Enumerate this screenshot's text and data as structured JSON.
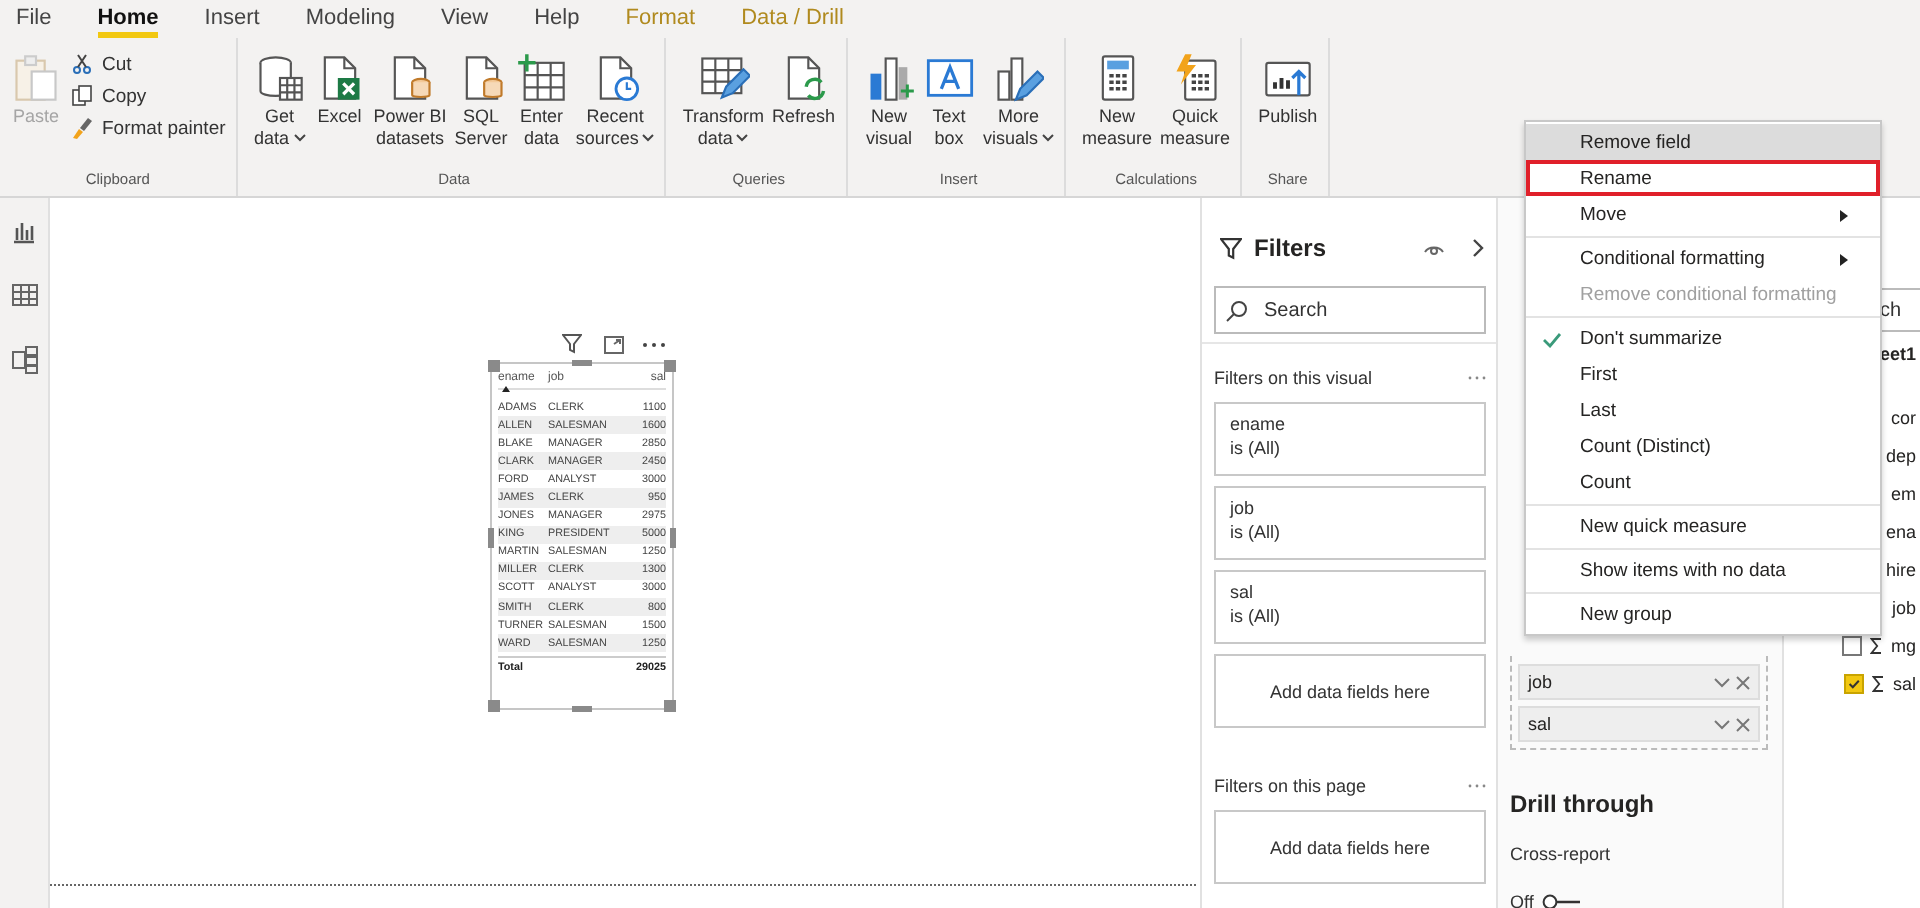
{
  "ribbon_tabs": [
    {
      "label": "File",
      "selected": false,
      "contextual": false
    },
    {
      "label": "Home",
      "selected": true,
      "contextual": false
    },
    {
      "label": "Insert",
      "selected": false,
      "contextual": false
    },
    {
      "label": "Modeling",
      "selected": false,
      "contextual": false
    },
    {
      "label": "View",
      "selected": false,
      "contextual": false
    },
    {
      "label": "Help",
      "selected": false,
      "contextual": false
    },
    {
      "label": "Format",
      "selected": false,
      "contextual": true
    },
    {
      "label": "Data / Drill",
      "selected": false,
      "contextual": true
    }
  ],
  "ribbon_groups": [
    {
      "label": "Clipboard",
      "buttons": [
        {
          "kind": "large",
          "lines": [
            "Paste"
          ],
          "disabled": true,
          "dropdown": false
        },
        {
          "kind": "small",
          "lines": [
            "Cut"
          ],
          "disabled": false,
          "dropdown": false
        },
        {
          "kind": "small",
          "lines": [
            "Copy"
          ],
          "disabled": false,
          "dropdown": false
        },
        {
          "kind": "small",
          "lines": [
            "Format painter"
          ],
          "disabled": false,
          "dropdown": false
        }
      ]
    },
    {
      "label": "Data",
      "buttons": [
        {
          "kind": "large",
          "lines": [
            "Get",
            "data"
          ],
          "disabled": false,
          "dropdown": true
        },
        {
          "kind": "large",
          "lines": [
            "Excel"
          ],
          "disabled": false,
          "dropdown": false
        },
        {
          "kind": "large",
          "lines": [
            "Power BI",
            "datasets"
          ],
          "disabled": false,
          "dropdown": false
        },
        {
          "kind": "large",
          "lines": [
            "SQL",
            "Server"
          ],
          "disabled": false,
          "dropdown": false
        },
        {
          "kind": "large",
          "lines": [
            "Enter",
            "data"
          ],
          "disabled": false,
          "dropdown": false
        },
        {
          "kind": "large",
          "lines": [
            "Recent",
            "sources"
          ],
          "disabled": false,
          "dropdown": true
        }
      ]
    },
    {
      "label": "Queries",
      "buttons": [
        {
          "kind": "large",
          "lines": [
            "Transform",
            "data"
          ],
          "disabled": false,
          "dropdown": true
        },
        {
          "kind": "large",
          "lines": [
            "Refresh"
          ],
          "disabled": false,
          "dropdown": false
        }
      ]
    },
    {
      "label": "Insert",
      "buttons": [
        {
          "kind": "large",
          "lines": [
            "New",
            "visual"
          ],
          "disabled": false,
          "dropdown": false
        },
        {
          "kind": "large",
          "lines": [
            "Text",
            "box"
          ],
          "disabled": false,
          "dropdown": false
        },
        {
          "kind": "large",
          "lines": [
            "More",
            "visuals"
          ],
          "disabled": false,
          "dropdown": true
        }
      ]
    },
    {
      "label": "Calculations",
      "buttons": [
        {
          "kind": "large",
          "lines": [
            "New",
            "measure"
          ],
          "disabled": false,
          "dropdown": false
        },
        {
          "kind": "large",
          "lines": [
            "Quick",
            "measure"
          ],
          "disabled": false,
          "dropdown": false
        }
      ]
    },
    {
      "label": "Share",
      "buttons": [
        {
          "kind": "large",
          "lines": [
            "Publish"
          ],
          "disabled": false,
          "dropdown": false
        }
      ]
    }
  ],
  "table_visual": {
    "columns": [
      "ename",
      "job",
      "sal"
    ],
    "rows": [
      [
        "ADAMS",
        "CLERK",
        "1100"
      ],
      [
        "ALLEN",
        "SALESMAN",
        "1600"
      ],
      [
        "BLAKE",
        "MANAGER",
        "2850"
      ],
      [
        "CLARK",
        "MANAGER",
        "2450"
      ],
      [
        "FORD",
        "ANALYST",
        "3000"
      ],
      [
        "JAMES",
        "CLERK",
        "950"
      ],
      [
        "JONES",
        "MANAGER",
        "2975"
      ],
      [
        "KING",
        "PRESIDENT",
        "5000"
      ],
      [
        "MARTIN",
        "SALESMAN",
        "1250"
      ],
      [
        "MILLER",
        "CLERK",
        "1300"
      ],
      [
        "SCOTT",
        "ANALYST",
        "3000"
      ],
      [
        "SMITH",
        "CLERK",
        "800"
      ],
      [
        "TURNER",
        "SALESMAN",
        "1500"
      ],
      [
        "WARD",
        "SALESMAN",
        "1250"
      ]
    ],
    "total": {
      "label": "Total",
      "value": "29025"
    }
  },
  "filters_pane": {
    "title": "Filters",
    "search_placeholder": "Search",
    "visual_section": {
      "title": "Filters on this visual",
      "cards": [
        {
          "field": "ename",
          "condition": "is (All)"
        },
        {
          "field": "job",
          "condition": "is (All)"
        },
        {
          "field": "sal",
          "condition": "is (All)"
        }
      ],
      "add_label": "Add data fields here"
    },
    "page_section": {
      "title": "Filters on this page",
      "add_label": "Add data fields here"
    }
  },
  "visualizations_pane": {
    "wells": [
      {
        "field": "job"
      },
      {
        "field": "sal"
      }
    ],
    "drill_title": "Drill through",
    "cross_report": {
      "label": "Cross-report",
      "toggle_label": "Off",
      "on": false
    }
  },
  "fields_pane": {
    "search_placeholder": "ch",
    "table_name": "eet1",
    "items": [
      {
        "name": "cor",
        "kind": "plain"
      },
      {
        "name": "dep",
        "kind": "plain"
      },
      {
        "name": "em",
        "kind": "plain"
      },
      {
        "name": "ena",
        "kind": "plain"
      },
      {
        "name": "hire",
        "kind": "plain"
      },
      {
        "name": "job",
        "kind": "plain"
      },
      {
        "name": "mg",
        "kind": "measure",
        "checked": false
      },
      {
        "name": "sal",
        "kind": "measure",
        "checked": true
      }
    ]
  },
  "context_menu": [
    {
      "label": "Remove field",
      "hovered": true,
      "outlined": false,
      "disabled": false,
      "checked": false,
      "submenu": false,
      "separator_before": false
    },
    {
      "label": "Rename",
      "hovered": false,
      "outlined": true,
      "disabled": false,
      "checked": false,
      "submenu": false,
      "separator_before": false
    },
    {
      "label": "Move",
      "hovered": false,
      "outlined": false,
      "disabled": false,
      "checked": false,
      "submenu": true,
      "separator_before": false
    },
    {
      "label": "Conditional formatting",
      "hovered": false,
      "outlined": false,
      "disabled": false,
      "checked": false,
      "submenu": true,
      "separator_before": true
    },
    {
      "label": "Remove conditional formatting",
      "hovered": false,
      "outlined": false,
      "disabled": true,
      "checked": false,
      "submenu": false,
      "separator_before": false
    },
    {
      "label": "Don't summarize",
      "hovered": false,
      "outlined": false,
      "disabled": false,
      "checked": true,
      "submenu": false,
      "separator_before": true
    },
    {
      "label": "First",
      "hovered": false,
      "outlined": false,
      "disabled": false,
      "checked": false,
      "submenu": false,
      "separator_before": false
    },
    {
      "label": "Last",
      "hovered": false,
      "outlined": false,
      "disabled": false,
      "checked": false,
      "submenu": false,
      "separator_before": false
    },
    {
      "label": "Count (Distinct)",
      "hovered": false,
      "outlined": false,
      "disabled": false,
      "checked": false,
      "submenu": false,
      "separator_before": false
    },
    {
      "label": "Count",
      "hovered": false,
      "outlined": false,
      "disabled": false,
      "checked": false,
      "submenu": false,
      "separator_before": false
    },
    {
      "label": "New quick measure",
      "hovered": false,
      "outlined": false,
      "disabled": false,
      "checked": false,
      "submenu": false,
      "separator_before": true
    },
    {
      "label": "Show items with no data",
      "hovered": false,
      "outlined": false,
      "disabled": false,
      "checked": false,
      "submenu": false,
      "separator_before": true
    },
    {
      "label": "New group",
      "hovered": false,
      "outlined": false,
      "disabled": false,
      "checked": false,
      "submenu": false,
      "separator_before": true
    }
  ]
}
